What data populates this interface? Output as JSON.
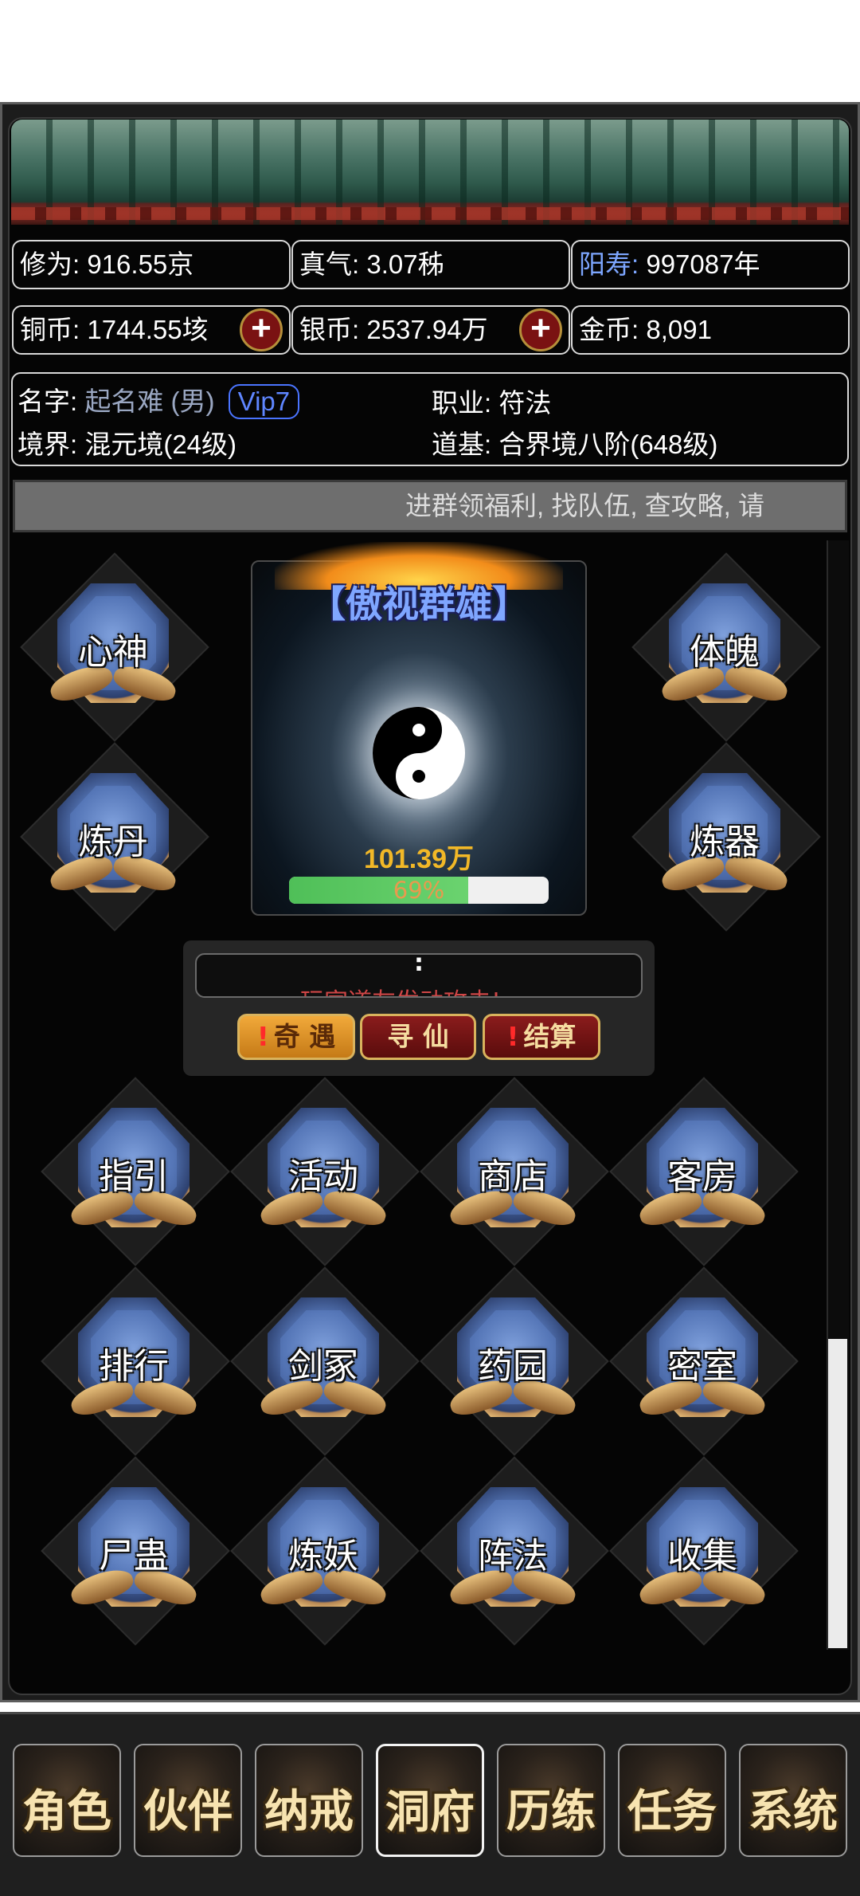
{
  "stats": {
    "xiuwei": {
      "label": "修为:",
      "value": "916.55京"
    },
    "zhenqi": {
      "label": "真气:",
      "value": "3.07秭"
    },
    "yangshou": {
      "label": "阳寿:",
      "value": "997087年"
    },
    "tongbi": {
      "label": "铜币:",
      "value": "1744.55垓"
    },
    "yinbi": {
      "label": "银币:",
      "value": "2537.94万"
    },
    "jinbi": {
      "label": "金币:",
      "value": "8,091"
    }
  },
  "profile": {
    "name_label": "名字:",
    "name_value": "起名难 (男)",
    "vip": "Vip7",
    "job_label": "职业:",
    "job_value": "符法",
    "realm_label": "境界:",
    "realm_value": "混元境(24级)",
    "foundation_label": "道基:",
    "foundation_value": "合界境八阶(648级)"
  },
  "marquee": "进群领福利, 找队伍, 查攻略, 请",
  "side_buttons": {
    "xinshen": "心神",
    "liandan": "炼丹",
    "tipo": "体魄",
    "lianqi": "炼器"
  },
  "center": {
    "title": "【傲视群雄】",
    "power": "101.39万",
    "progress_label": "69%",
    "progress": 0.69
  },
  "message": {
    "colon": ":",
    "scroll_text": "玩家道友发动攻击!"
  },
  "actions": {
    "qiyu": "奇 遇",
    "xunxian": "寻 仙",
    "jiesuan": "结算",
    "alert": "!"
  },
  "grid": {
    "row1": [
      "指引",
      "活动",
      "商店",
      "客房"
    ],
    "row2": [
      "排行",
      "剑冢",
      "药园",
      "密室"
    ],
    "row3": [
      "尸蛊",
      "炼妖",
      "阵法",
      "收集"
    ]
  },
  "nav": [
    "角色",
    "伙伴",
    "纳戒",
    "洞府",
    "历练",
    "任务",
    "系统"
  ]
}
